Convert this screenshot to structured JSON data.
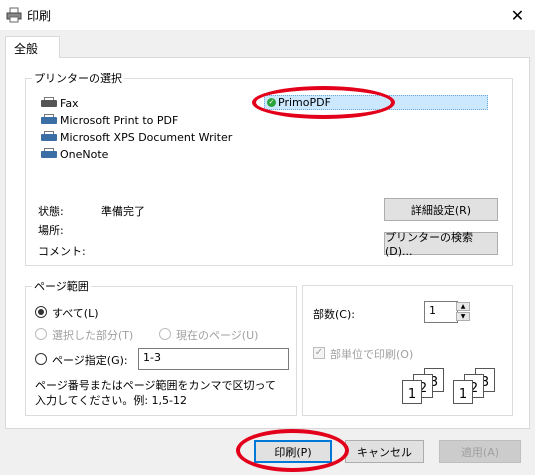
{
  "window": {
    "title": "印刷",
    "close_glyph": "✕"
  },
  "tabs": [
    {
      "label": "全般"
    }
  ],
  "printer_group": {
    "legend": "プリンターの選択",
    "printers": [
      {
        "name": "Fax"
      },
      {
        "name": "Microsoft Print to PDF"
      },
      {
        "name": "Microsoft XPS Document Writer"
      },
      {
        "name": "OneNote"
      }
    ],
    "selected": {
      "name": "PrimoPDF"
    },
    "status_label": "状態:",
    "status_value": "準備完了",
    "location_label": "場所:",
    "comment_label": "コメント:",
    "preferences_button": "詳細設定(R)",
    "find_printer_button": "プリンターの検索(D)..."
  },
  "page_range": {
    "legend": "ページ範囲",
    "all_label": "すべて(L)",
    "selection_label": "選択した部分(T)",
    "current_page_label": "現在のページ(U)",
    "pages_label": "ページ指定(G):",
    "pages_value": "1-3",
    "hint": "ページ番号またはページ範囲をカンマで区切って入力してください。例: 1,5-12"
  },
  "copies": {
    "label": "部数(C):",
    "value": "1",
    "collate_label": "部単位で印刷(O)",
    "stack_pages": [
      "1",
      "2",
      "3"
    ]
  },
  "buttons": {
    "print": "印刷(P)",
    "cancel": "キャンセル",
    "apply": "適用(A)"
  },
  "colors": {
    "accent": "#0078d7",
    "annotation": "#e3001b",
    "selection": "#cce8ff"
  }
}
